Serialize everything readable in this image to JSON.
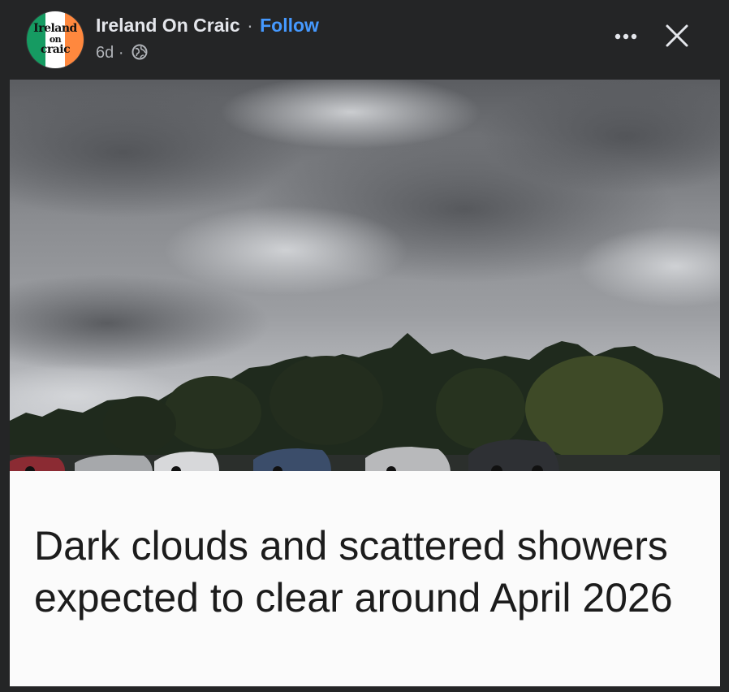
{
  "post": {
    "page_name": "Ireland On Craic",
    "separator": "·",
    "follow_label": "Follow",
    "time_ago": "6d",
    "meta_separator": "·",
    "privacy_icon": "globe-icon",
    "avatar": {
      "line1": "Ireland",
      "line2": "on",
      "line3": "craic",
      "colors": [
        "#169b62",
        "#ffffff",
        "#ff883e"
      ]
    }
  },
  "actions": {
    "more_icon": "more-horizontal-icon",
    "close_icon": "close-icon"
  },
  "image": {
    "caption": "Dark clouds and scattered showers expected to clear around April 2026"
  },
  "theme": {
    "header_bg": "#242526",
    "name_color": "#e4e6eb",
    "follow_color": "#4599ff",
    "meta_color": "#b0b3b8"
  }
}
